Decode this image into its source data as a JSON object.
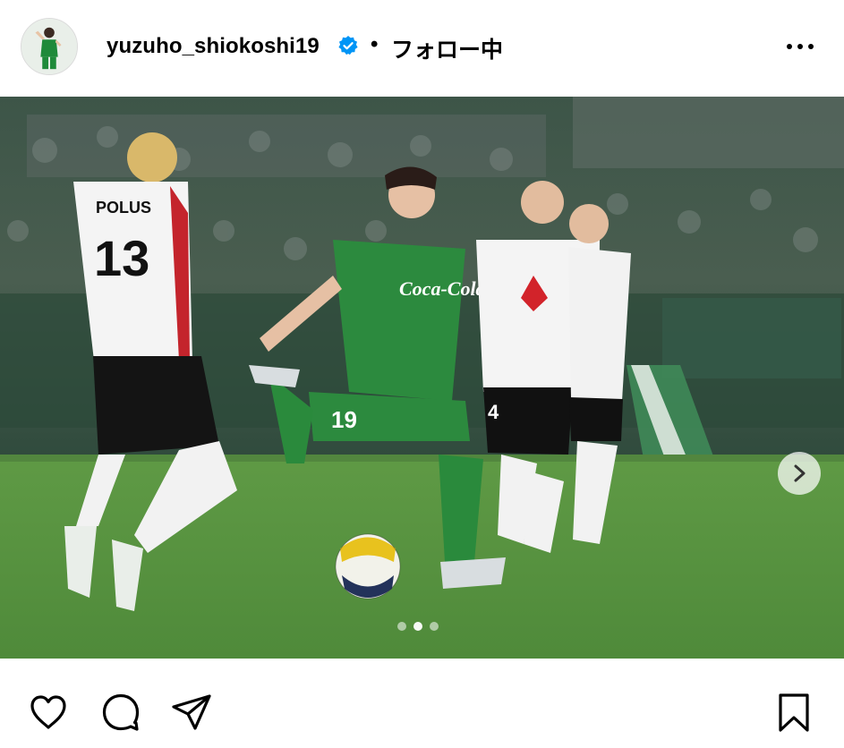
{
  "header": {
    "username": "yuzuho_shiokoshi19",
    "separator": "•",
    "follow_label": "フォロー中"
  },
  "post": {
    "image_slides": 3,
    "active_slide": 2
  },
  "icons": {
    "verified": "verified-badge-icon",
    "more": "more-options-icon",
    "next": "chevron-right-icon",
    "like": "heart-icon",
    "comment": "comment-bubble-icon",
    "share": "paper-plane-icon",
    "save": "bookmark-icon"
  },
  "colors": {
    "verified_blue": "#0095f6",
    "text": "#000000",
    "background": "#ffffff"
  }
}
